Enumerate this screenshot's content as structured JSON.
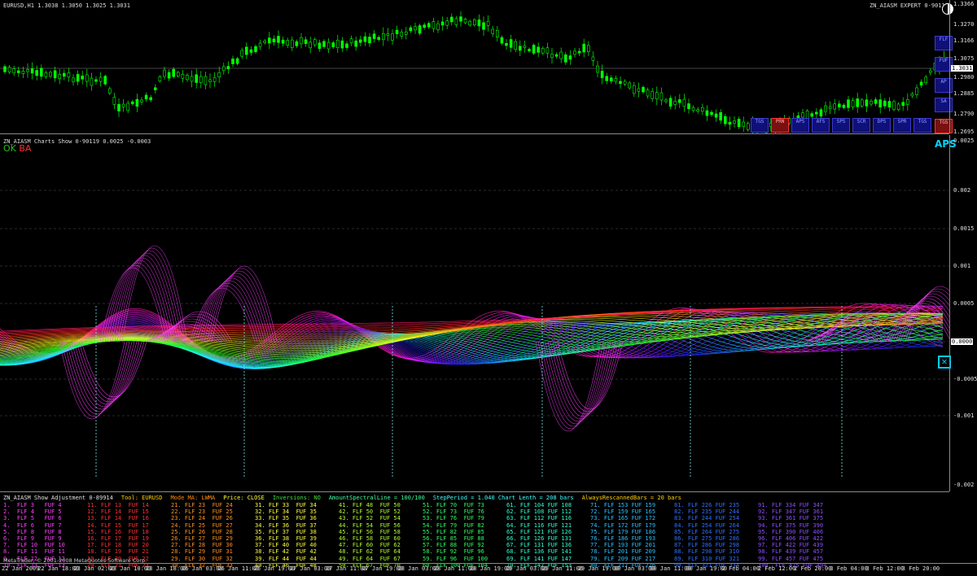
{
  "price_pane": {
    "header": "EURUSD,H1  1.3038 1.3050 1.3025 1.3031",
    "expert_label": "ZN_AIASM EXPERT 0-90119",
    "scale": [
      "1.3366",
      "1.3270",
      "1.3166",
      "1.3075",
      "1.3031",
      "1.2980",
      "1.2885",
      "1.2790",
      "1.2695"
    ],
    "current_price": "1.3031",
    "right_buttons": [
      "FLF",
      "FUF",
      "AP",
      "SA",
      "TGS"
    ],
    "bottom_buttons": [
      "TGS",
      "PRN",
      "APS",
      "AFS",
      "SPS",
      "SCR",
      "DPS",
      "SPR",
      "TGS"
    ]
  },
  "indicator_pane": {
    "header": "ZN_AIASM Charts Show 0-90119 0.0025 -0.0003",
    "ok": "OK",
    "ba": "BA",
    "badge": "APS",
    "close_glyph": "✕",
    "scale": [
      "0.0025",
      "0.002",
      "0.0015",
      "0.001",
      "0.0005",
      "0.0000",
      "-0.0005",
      "-0.001",
      "-0.002"
    ]
  },
  "adjust_pane": {
    "header_parts": [
      {
        "text": "ZN_AIASM Show Adjustment 0-89914",
        "color": "#e0e0e0"
      },
      {
        "text": "Tool: EURUSD",
        "color": "#ffd000"
      },
      {
        "text": "Mode MA: LWMA",
        "color": "#ff8c00"
      },
      {
        "text": "Price: CLOSE",
        "color": "#ffff40"
      },
      {
        "text": "Inversions: NO",
        "color": "#40e040"
      },
      {
        "text": "AmountSpectralLine = 100/100",
        "color": "#40ffa0"
      },
      {
        "text": "StepPeriod = 1.040 Chart Lenth = 208 bars",
        "color": "#40ffff"
      },
      {
        "text": "AlwaysRescannedBars = 20 bars",
        "color": "#ffd000"
      }
    ],
    "columns": [
      {
        "color": "#ff40ff",
        "lines": [
          "1.  FLF 3   FUF 4",
          "2.  FLF 4   FUF 5",
          "3.  FLF 5   FUF 6",
          "4.  FLF 6   FUF 7",
          "5.  FLF 8   FUF 8",
          "6.  FLF 9   FUF 9",
          "7.  FLF 10  FUF 10",
          "8.  FLF 11  FUF 11",
          "9.  FLF 12  FUF 12",
          "10. FLF 13  FUF 13"
        ]
      },
      {
        "color": "#ff3030",
        "lines": [
          "11. FLF 13  FUF 14",
          "12. FLF 14  FUF 15",
          "13. FLF 14  FUF 16",
          "14. FLF 15  FUF 17",
          "15. FLF 16  FUF 18",
          "16. FLF 17  FUF 19",
          "17. FLF 18  FUF 20",
          "18. FLF 19  FUF 21",
          "19. FLF 20  FUF 22",
          "20. FLF 21  FUF 23"
        ]
      },
      {
        "color": "#ff9020",
        "lines": [
          "21. FLF 23  FUF 24",
          "22. FLF 23  FUF 25",
          "23. FLF 24  FUF 26",
          "24. FLF 25  FUF 27",
          "25. FLF 26  FUF 28",
          "26. FLF 27  FUF 29",
          "27. FLF 28  FUF 30",
          "28. FLF 29  FUF 31",
          "29. FLF 30  FUF 32",
          "30. FLF 32  FUF 33"
        ]
      },
      {
        "color": "#ffff40",
        "lines": [
          "31. FLF 33  FUF 34",
          "32. FLF 34  FUF 35",
          "33. FLF 35  FUF 36",
          "34. FLF 36  FUF 37",
          "35. FLF 37  FUF 38",
          "36. FLF 38  FUF 39",
          "37. FLF 40  FUF 40",
          "38. FLF 42  FUF 42",
          "39. FLF 44  FUF 44",
          "40. FLF 46  FUF 48"
        ]
      },
      {
        "color": "#b0ff30",
        "lines": [
          "41. FLF 48  FUF 50",
          "42. FLF 50  FUF 52",
          "43. FLF 52  FUF 54",
          "44. FLF 54  FUF 56",
          "45. FLF 56  FUF 58",
          "46. FLF 58  FUF 60",
          "47. FLF 60  FUF 62",
          "48. FLF 62  FUF 64",
          "49. FLF 64  FUF 67",
          "50. FLF 67  FUF 70"
        ]
      },
      {
        "color": "#30ff60",
        "lines": [
          "51. FLF 70  FUF 73",
          "52. FLF 73  FUF 76",
          "53. FLF 76  FUF 79",
          "54. FLF 79  FUF 82",
          "55. FLF 82  FUF 85",
          "56. FLF 85  FUF 88",
          "57. FLF 88  FUF 92",
          "58. FLF 92  FUF 96",
          "59. FLF 96  FUF 100",
          "60. FLF 100 FUF 104"
        ]
      },
      {
        "color": "#30ffd0",
        "lines": [
          "61. FLF 104 FUF 108",
          "62. FLF 108 FUF 112",
          "63. FLF 112 FUF 116",
          "64. FLF 116 FUF 121",
          "65. FLF 121 FUF 126",
          "66. FLF 126 FUF 131",
          "67. FLF 131 FUF 136",
          "68. FLF 136 FUF 141",
          "69. FLF 141 FUF 147",
          "70. FLF 147 FUF 153"
        ]
      },
      {
        "color": "#30c0ff",
        "lines": [
          "71. FLF 153 FUF 159",
          "72. FLF 159 FUF 165",
          "73. FLF 165 FUF 172",
          "74. FLF 172 FUF 179",
          "75. FLF 179 FUF 186",
          "76. FLF 186 FUF 193",
          "77. FLF 193 FUF 201",
          "78. FLF 201 FUF 209",
          "79. FLF 209 FUF 217",
          "80. FLF 217 FUF 226"
        ]
      },
      {
        "color": "#3070ff",
        "lines": [
          "81. FLF 226 FUF 235",
          "82. FLF 235 FUF 244",
          "83. FLF 244 FUF 254",
          "84. FLF 254 FUF 264",
          "85. FLF 264 FUF 275",
          "86. FLF 275 FUF 286",
          "87. FLF 286 FUF 298",
          "88. FLF 298 FUF 310",
          "89. FLF 310 FUF 321",
          "90. FLF 321 FUF 334"
        ]
      },
      {
        "color": "#9050ff",
        "lines": [
          "91. FLF 334 FUF 347",
          "92. FLF 347 FUF 361",
          "93. FLF 361 FUF 375",
          "94. FLF 375 FUF 390",
          "95. FLF 390 FUF 406",
          "96. FLF 406 FUF 422",
          "97. FLF 422 FUF 439",
          "98. FLF 439 FUF 457",
          "99. FLF 457 FUF 475",
          "100. FLF 475 FUF 494"
        ]
      }
    ]
  },
  "copyright": "MetaTrader, © 2001-2008 MetaQuotes Software Corp.",
  "time_axis": [
    "22 Jan 2009",
    "22 Jan 18:00",
    "23 Jan 02:00",
    "23 Jan 10:00",
    "23 Jan 18:00",
    "26 Jan 03:00",
    "26 Jan 11:00",
    "26 Jan 19:00",
    "27 Jan 03:00",
    "27 Jan 11:00",
    "27 Jan 19:00",
    "28 Jan 03:00",
    "28 Jan 11:00",
    "28 Jan 19:00",
    "29 Jan 03:00",
    "29 Jan 11:00",
    "29 Jan 19:00",
    "30 Jan 03:00",
    "30 Jan 11:00",
    "30 Jan 19:00",
    "2 Feb 04:00",
    "2 Feb 12:00",
    "2 Feb 20:00",
    "3 Feb 04:00",
    "3 Feb 12:00",
    "3 Feb 20:00"
  ],
  "colors": {
    "bull": "#00ff00",
    "bear": "#00ff00",
    "grid": "#505050",
    "scale_text": "#e0e0e0"
  }
}
